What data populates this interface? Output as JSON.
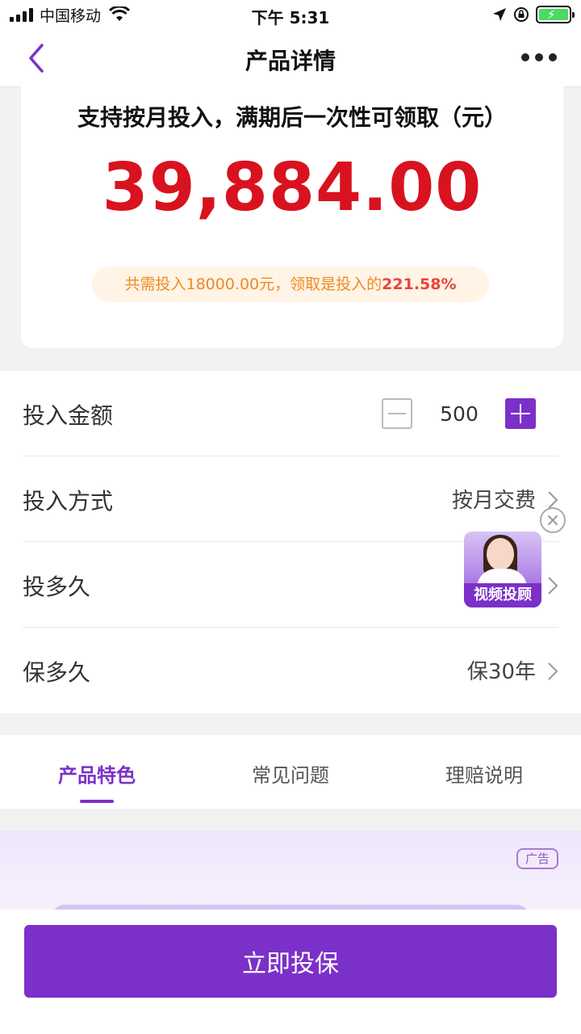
{
  "status_bar": {
    "carrier": "中国移动",
    "time": "下午 5:31"
  },
  "nav": {
    "title": "产品详情",
    "back_icon": "chevron-left-icon",
    "more_icon": "more-dots-icon"
  },
  "summary": {
    "description": "支持按月投入，满期后一次性可领取（元）",
    "amount": "39,884.00",
    "note_prefix": "共需投入18000.00元，领取是投入的",
    "note_ratio": "221.58%"
  },
  "form": {
    "amount_label": "投入金额",
    "amount_value": "500",
    "method_label": "投入方式",
    "method_value": "按月交费",
    "duration_label": "投多久",
    "duration_value": "",
    "coverage_label": "保多久",
    "coverage_value": "保30年"
  },
  "advisor": {
    "label": "视频投顾"
  },
  "tabs": [
    {
      "label": "产品特色",
      "active": true
    },
    {
      "label": "常见问题",
      "active": false
    },
    {
      "label": "理赔说明",
      "active": false
    }
  ],
  "ad": {
    "badge": "广告"
  },
  "cta": {
    "label": "立即投保"
  },
  "colors": {
    "accent": "#7b30c9",
    "amount": "#d9121f",
    "note": "#f08a24",
    "ratio": "#e8453c"
  }
}
